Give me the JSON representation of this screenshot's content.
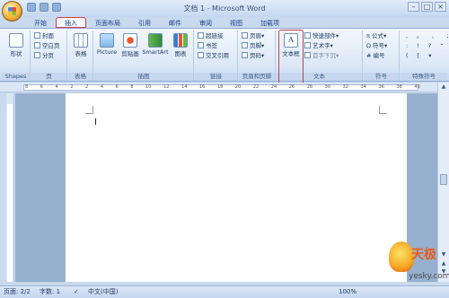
{
  "window": {
    "title": "文档 1 - Microsoft Word",
    "controls": [
      "–",
      "□",
      "×"
    ]
  },
  "tabs": [
    "开始",
    "插入",
    "页面布局",
    "引用",
    "邮件",
    "审阅",
    "视图",
    "加载项"
  ],
  "active_tab": "插入",
  "ribbon": {
    "pages": {
      "label": "页",
      "items": [
        "封面",
        "空白页",
        "分页"
      ]
    },
    "shapes_group": {
      "label": "Shapes",
      "btn": "形状"
    },
    "table": {
      "label": "表格",
      "btn": "表格"
    },
    "illustrations": {
      "label": "插图",
      "items": [
        "Picture",
        "剪贴画",
        "SmartArt",
        "图表"
      ]
    },
    "links": {
      "label": "链接",
      "items": [
        "超链接",
        "书签",
        "交叉引用"
      ]
    },
    "header_footer": {
      "label": "页眉和页脚",
      "items": [
        "页眉",
        "页脚",
        "页码"
      ]
    },
    "text": {
      "label": "文本",
      "big": "文本框",
      "items": [
        "快速部件",
        "艺术字",
        "首字下沉"
      ]
    },
    "symbols": {
      "label": "符号",
      "items": [
        "公式",
        "符号",
        "编号"
      ]
    },
    "special": {
      "label": "特殊符号"
    }
  },
  "ruler_numbers": [
    "8",
    "6",
    "4",
    "2",
    "2",
    "4",
    "6",
    "8",
    "10",
    "12",
    "14",
    "16",
    "18",
    "20",
    "22",
    "24",
    "26",
    "28",
    "30",
    "32",
    "34",
    "36",
    "38",
    "40"
  ],
  "status": {
    "page": "页面: 2/2",
    "words": "字数: 1",
    "lang": "中文(中国)",
    "zoom": "100%"
  },
  "watermark": {
    "brand": "天极",
    "site": "yesky.com"
  }
}
